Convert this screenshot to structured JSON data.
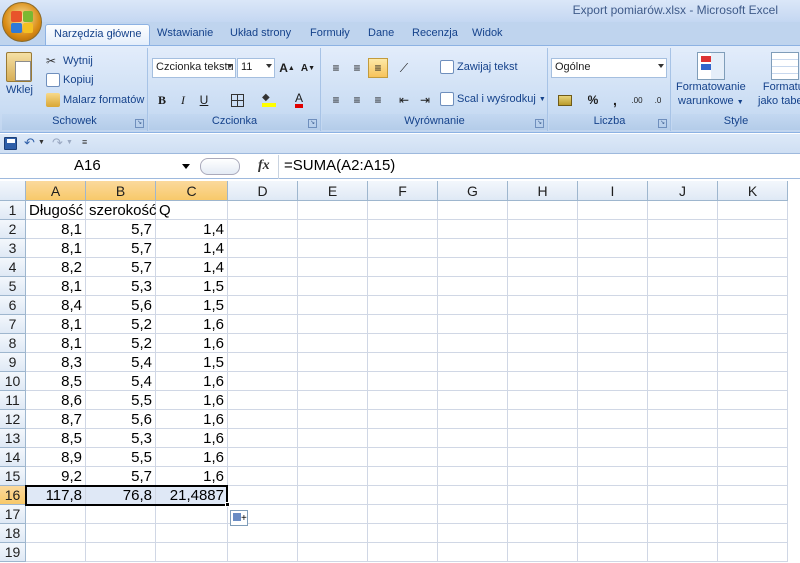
{
  "window": {
    "title": "Export pomiarów.xlsx - Microsoft Excel"
  },
  "tabs": [
    "Narzędzia główne",
    "Wstawianie",
    "Układ strony",
    "Formuły",
    "Dane",
    "Recenzja",
    "Widok"
  ],
  "ribbon": {
    "clipboard": {
      "label": "Schowek",
      "paste": "Wklej",
      "cut": "Wytnij",
      "copy": "Kopiuj",
      "format_painter": "Malarz formatów"
    },
    "font": {
      "label": "Czcionka",
      "font_name": "Czcionka tekstu",
      "font_size": "11",
      "bold": "B",
      "italic": "I",
      "underline": "U",
      "color_letter": "A",
      "grow": "A",
      "shrink": "A"
    },
    "alignment": {
      "label": "Wyrównanie",
      "wrap_text": "Zawijaj tekst",
      "merge_center": "Scal i wyśrodkuj"
    },
    "number": {
      "label": "Liczba",
      "format": "Ogólne",
      "percent": "%",
      "comma": ","
    },
    "styles": {
      "label": "Style",
      "conditional_line1": "Formatowanie",
      "conditional_line2": "warunkowe",
      "table_line1": "Formatuj",
      "table_line2": "jako tabelę"
    }
  },
  "formula_bar": {
    "name_box": "A16",
    "fx": "fx",
    "formula": "=SUMA(A2:A15)"
  },
  "columns": [
    "A",
    "B",
    "C",
    "D",
    "E",
    "F",
    "G",
    "H",
    "I",
    "J",
    "K"
  ],
  "rows": [
    "1",
    "2",
    "3",
    "4",
    "5",
    "6",
    "7",
    "8",
    "9",
    "10",
    "11",
    "12",
    "13",
    "14",
    "15",
    "16",
    "17",
    "18",
    "19"
  ],
  "sheet": {
    "header": [
      "Długość",
      "szerokość",
      "Q"
    ],
    "data": [
      [
        "8,1",
        "5,7",
        "1,4"
      ],
      [
        "8,1",
        "5,7",
        "1,4"
      ],
      [
        "8,2",
        "5,7",
        "1,4"
      ],
      [
        "8,1",
        "5,3",
        "1,5"
      ],
      [
        "8,4",
        "5,6",
        "1,5"
      ],
      [
        "8,1",
        "5,2",
        "1,6"
      ],
      [
        "8,1",
        "5,2",
        "1,6"
      ],
      [
        "8,3",
        "5,4",
        "1,5"
      ],
      [
        "8,5",
        "5,4",
        "1,6"
      ],
      [
        "8,6",
        "5,5",
        "1,6"
      ],
      [
        "8,7",
        "5,6",
        "1,6"
      ],
      [
        "8,5",
        "5,3",
        "1,6"
      ],
      [
        "8,9",
        "5,5",
        "1,6"
      ],
      [
        "9,2",
        "5,7",
        "1,6"
      ]
    ],
    "totals": [
      "117,8",
      "76,8",
      "21,4887"
    ]
  },
  "colors": {
    "accent": "#15428b",
    "selection": "#dfe8f6",
    "header_highlight": "#f8c96a"
  }
}
